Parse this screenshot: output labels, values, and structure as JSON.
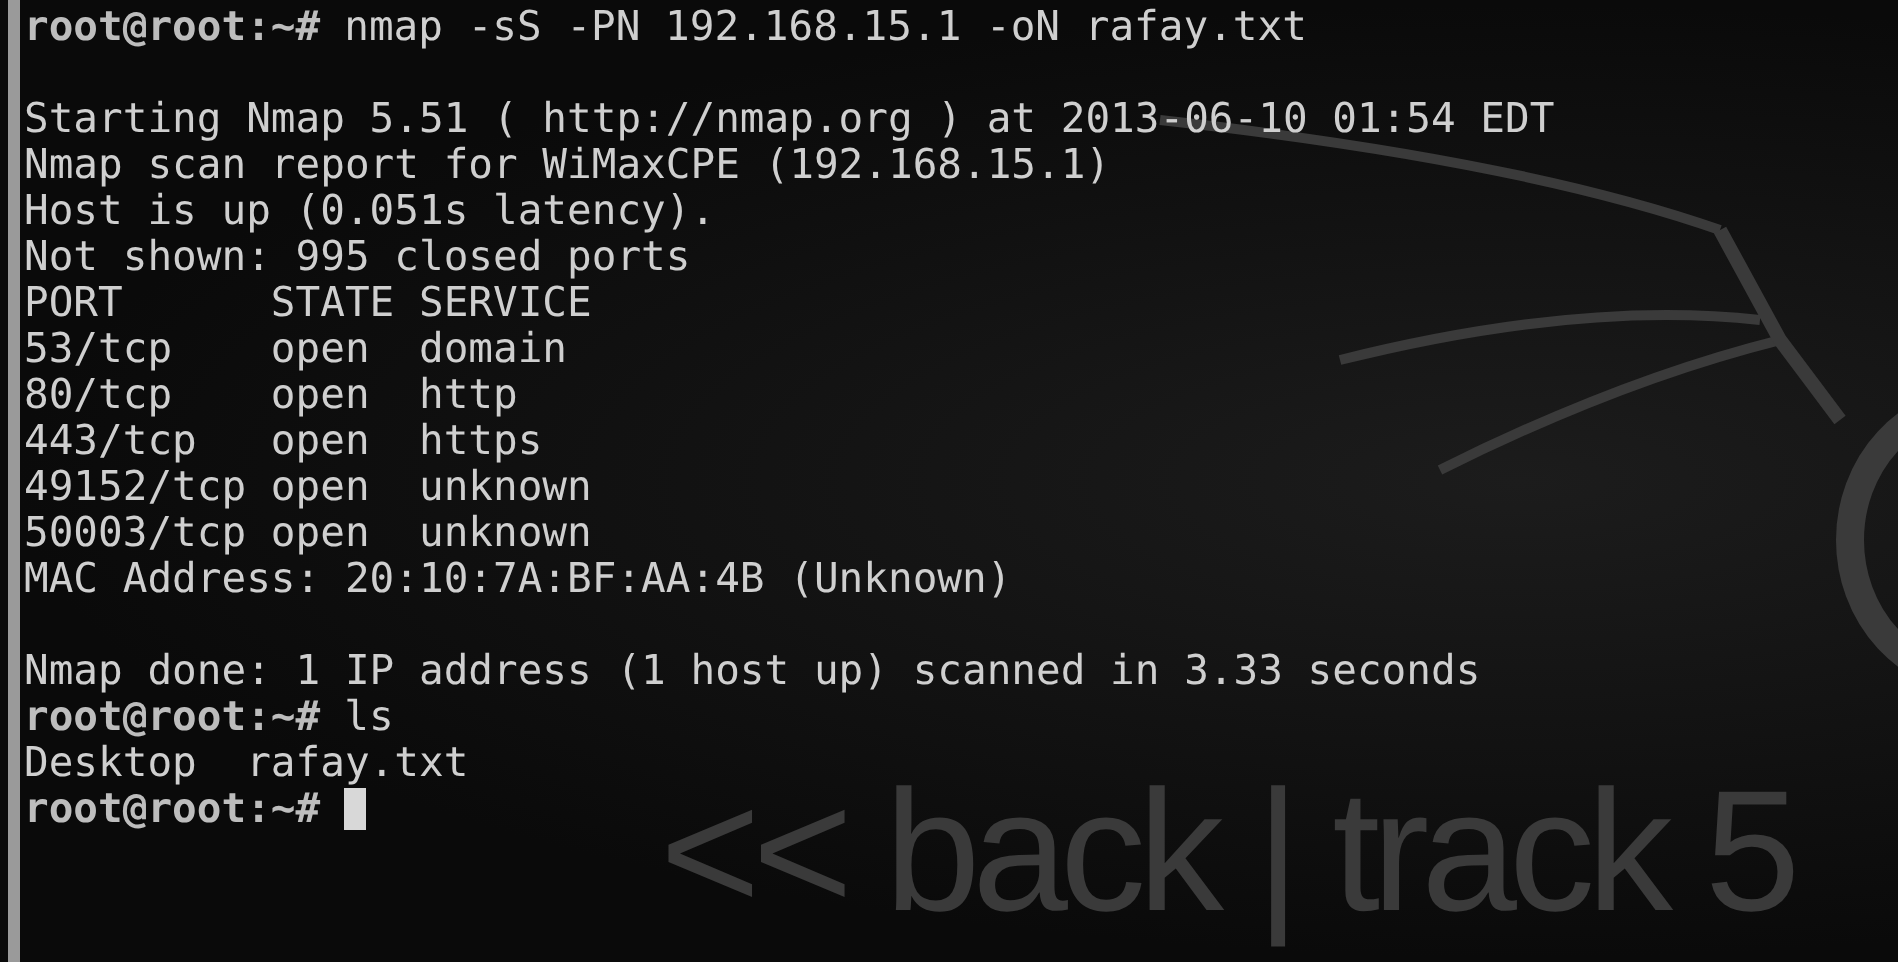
{
  "wallpaper": {
    "logo_text": "<< back | track 5"
  },
  "lines": [
    {
      "kind": "prompt",
      "prompt": "root@root:~#",
      "command": "nmap -sS -PN 192.168.15.1 -oN rafay.txt"
    },
    {
      "kind": "blank"
    },
    {
      "kind": "output",
      "text": "Starting Nmap 5.51 ( http://nmap.org ) at 2013-06-10 01:54 EDT"
    },
    {
      "kind": "output",
      "text": "Nmap scan report for WiMaxCPE (192.168.15.1)"
    },
    {
      "kind": "output",
      "text": "Host is up (0.051s latency)."
    },
    {
      "kind": "output",
      "text": "Not shown: 995 closed ports"
    },
    {
      "kind": "output",
      "text": "PORT      STATE SERVICE"
    },
    {
      "kind": "output",
      "text": "53/tcp    open  domain"
    },
    {
      "kind": "output",
      "text": "80/tcp    open  http"
    },
    {
      "kind": "output",
      "text": "443/tcp   open  https"
    },
    {
      "kind": "output",
      "text": "49152/tcp open  unknown"
    },
    {
      "kind": "output",
      "text": "50003/tcp open  unknown"
    },
    {
      "kind": "output",
      "text": "MAC Address: 20:10:7A:BF:AA:4B (Unknown)"
    },
    {
      "kind": "blank"
    },
    {
      "kind": "output",
      "text": "Nmap done: 1 IP address (1 host up) scanned in 3.33 seconds"
    },
    {
      "kind": "prompt",
      "prompt": "root@root:~#",
      "command": "ls"
    },
    {
      "kind": "output",
      "text": "Desktop  rafay.txt"
    },
    {
      "kind": "prompt",
      "prompt": "root@root:~#",
      "cursor": true
    }
  ]
}
